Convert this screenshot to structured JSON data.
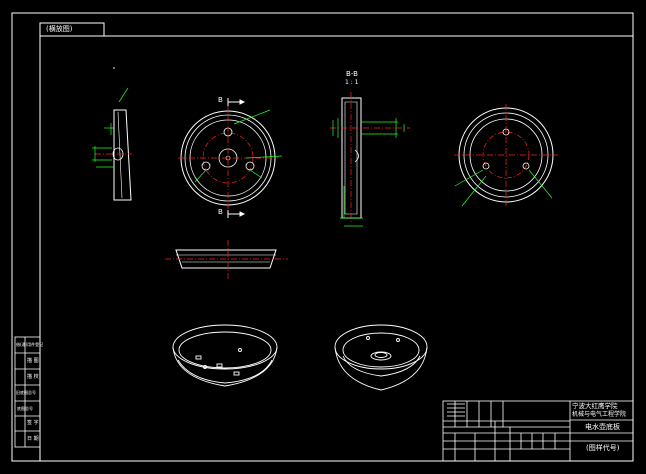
{
  "sheet": {
    "orientation_tag": "(横放图)",
    "colors": {
      "background": "#000000",
      "outline": "#ffffff",
      "centerline": "#ff2020",
      "dimension": "#20ff20"
    }
  },
  "views": {
    "section_title": "B-B",
    "section_scale": "1 : 1",
    "section_marker": "B"
  },
  "title_block": {
    "school_line1": "宁波大红鹰学院",
    "school_line2": "机械与电气工程学院",
    "part_name": "电水壶底板",
    "drawing_no": "(图样代号)"
  },
  "side_strip": {
    "cells": [
      "借(通)用件登记",
      "描 图",
      "描 校",
      "旧底图总号",
      "底图总号",
      "签 字",
      "日 期"
    ]
  }
}
